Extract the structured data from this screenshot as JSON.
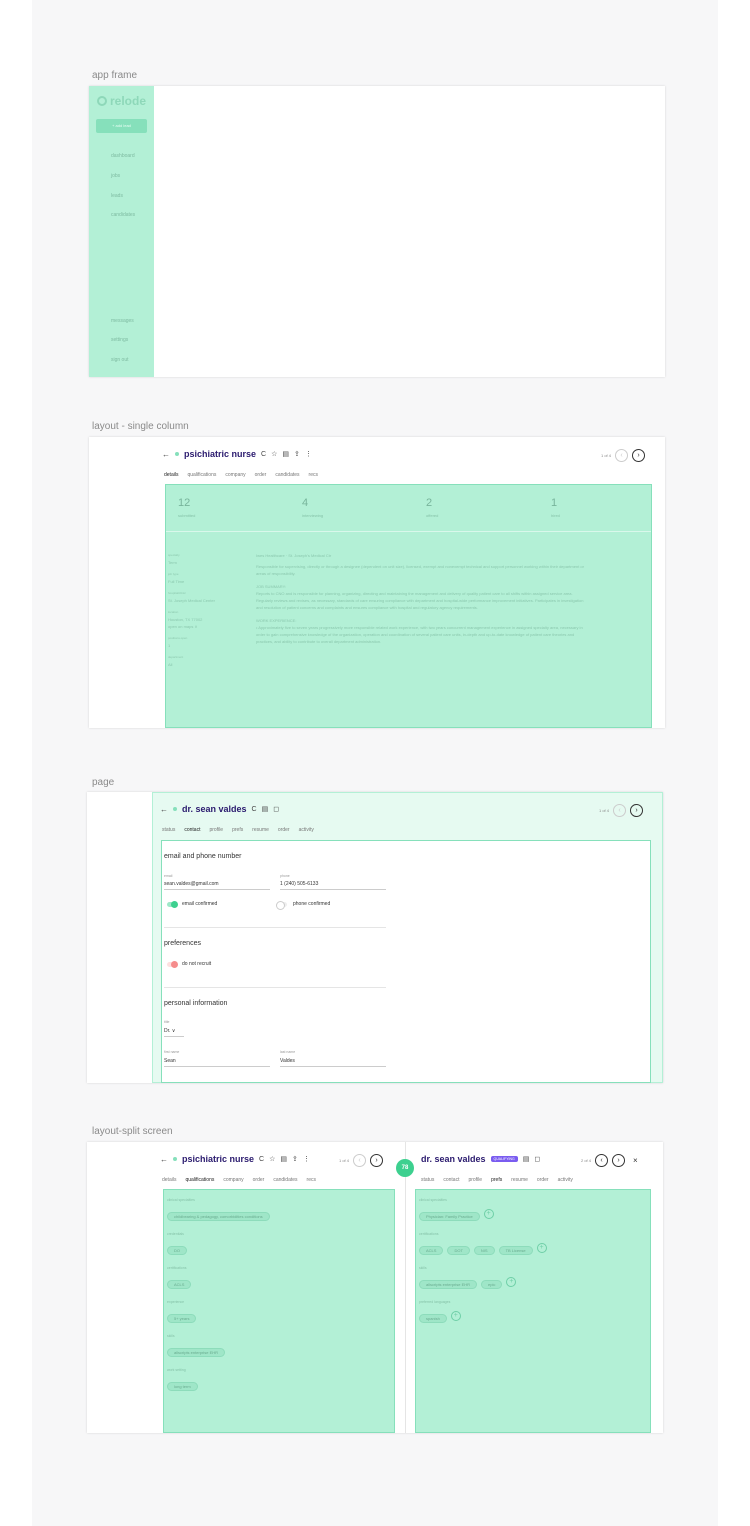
{
  "sections": {
    "app_frame": "app frame",
    "single_column": "layout - single column",
    "page": "page",
    "split_screen": "layout-split screen"
  },
  "app": {
    "logo": "relode",
    "add_lead": "+ add lead",
    "nav": [
      "dashboard",
      "jobs",
      "leads",
      "candidates"
    ],
    "nav_bottom": [
      "messages",
      "settings",
      "sign out"
    ]
  },
  "job": {
    "title": "psichiatric nurse",
    "pager": "1 of 4",
    "tabs": [
      "details",
      "qualifications",
      "company",
      "order",
      "candidates",
      "recs"
    ],
    "stats": [
      {
        "value": "12",
        "label": "submitted"
      },
      {
        "value": "4",
        "label": "interviewing"
      },
      {
        "value": "2",
        "label": "offered"
      },
      {
        "value": "1",
        "label": "hired"
      }
    ],
    "left_fields": [
      {
        "label": "specialty",
        "value": "Term"
      },
      {
        "label": "job type",
        "value": "Full Time"
      },
      {
        "label": "hospital/clinic",
        "value": "St. Joseph Medical Center"
      },
      {
        "label": "location",
        "value": "Houston, TX 77002"
      },
      {
        "label": "map",
        "value": "open on maps ∨"
      },
      {
        "label": "positions open",
        "value": "1"
      },
      {
        "label": "department",
        "value": "All"
      }
    ],
    "desc_heading": "Iwes Healthcare · St. Joseph's Medical Ctr",
    "desc_para1": "Responsible for supervising, directly or through a designee (dependent on unit size), licensed, exempt and nonexempt technical and support personnel working within their department or areas of responsibility.",
    "summary_heading": "JOB SUMMARY:",
    "summary_text": "Reports to CNO and is responsible for planning, organizing, directing and maintaining the management and delivery of quality patient care to all shifts within assigned service area. Regularly reviews and revises, as necessary, standards of care ensuring compliance with department and hospital-wide performance improvement initiatives. Participates in investigation and resolution of patient concerns and complaints and ensures compliance with hospital and regulatory agency requirements.",
    "work_heading": "WORK EXPERIENCE:",
    "work_text": "• Approximately five to seven years progressively more responsible related work experience, with two years concurrent management experience in assigned specialty area, necessary in order to gain comprehensive knowledge of the organization, operation and coordination of several patient care units, in-depth and up-to-date knowledge of patient care theories and practices, and ability to contribute to overall department administration."
  },
  "candidate": {
    "title": "dr. sean valdes",
    "pager": "1 of 4",
    "tabs": [
      "status",
      "contact",
      "profile",
      "prefs",
      "resume",
      "order",
      "activity"
    ],
    "section_email": "email and phone number",
    "email_label": "email",
    "email": "sean.valdes@gmail.com",
    "phone_label": "phone",
    "phone": "1 (240) 505-6133",
    "email_confirmed": "email confirmed",
    "phone_confirmed": "phone confirmed",
    "section_prefs": "preferences",
    "do_not_recruit": "do not recruit",
    "section_personal": "personal information",
    "title_label": "title",
    "title_value": "Dr. ∨",
    "first_label": "first name",
    "first_name": "Sean",
    "last_label": "last name",
    "last_name": "Valdes"
  },
  "split": {
    "job_pager": "1 of 4",
    "cand_pager": "2 of 4",
    "score": "78",
    "badge": "QUALIFYING",
    "left_groups": [
      {
        "label": "clinical specialties",
        "values": [
          "childbearing & pedagogy, comorbidities conditions"
        ]
      },
      {
        "label": "credentials",
        "values": [
          "DO"
        ]
      },
      {
        "label": "certifications",
        "values": [
          "ACLS"
        ]
      },
      {
        "label": "experience",
        "values": [
          "5+ years"
        ]
      },
      {
        "label": "skills",
        "values": [
          "allscripts enterprise EHR"
        ]
      },
      {
        "label": "work setting",
        "values": [
          "long term"
        ]
      }
    ],
    "right_groups": [
      {
        "label": "clinical specialties",
        "values": [
          "Physician: Family Practice"
        ]
      },
      {
        "label": "certifications",
        "values": [
          "ACLS",
          "DOT",
          "NIS",
          "TB License"
        ]
      },
      {
        "label": "skills",
        "values": [
          "allscripts enterprise EHR",
          "epic"
        ]
      },
      {
        "label": "preferred languages",
        "values": [
          "spanish"
        ]
      }
    ]
  }
}
